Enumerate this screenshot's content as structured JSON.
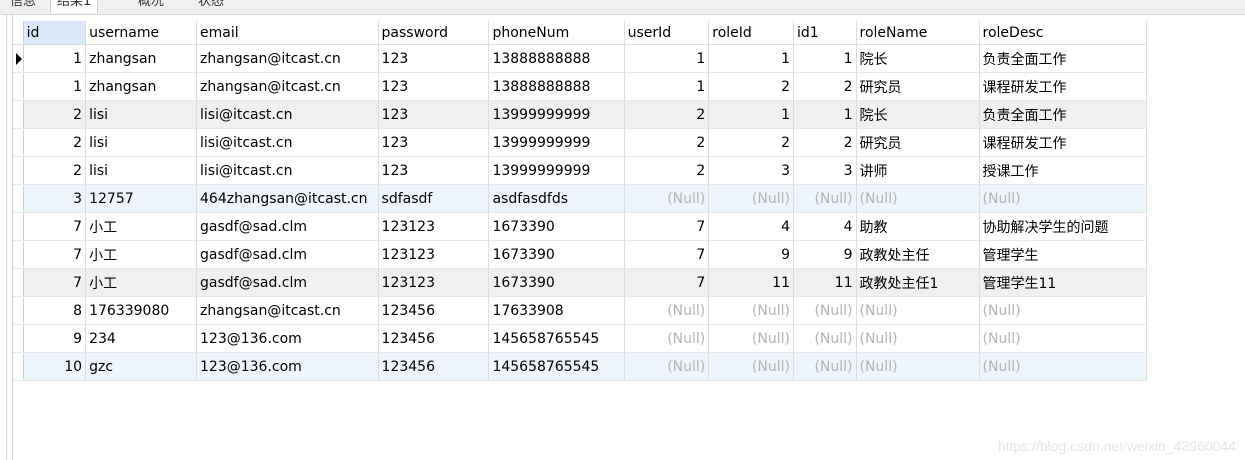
{
  "tabs": [
    {
      "label": "信息",
      "active": false
    },
    {
      "label": "结果1",
      "active": true
    },
    {
      "label": "概况",
      "active": false
    },
    {
      "label": "状态",
      "active": false
    }
  ],
  "null_text": "(Null)",
  "columns": [
    "id",
    "username",
    "email",
    "password",
    "phoneNum",
    "userId",
    "roleId",
    "id1",
    "roleName",
    "roleDesc"
  ],
  "rows": [
    [
      "1",
      "zhangsan",
      "zhangsan@itcast.cn",
      "123",
      "13888888888",
      "1",
      "1",
      "1",
      "院长",
      "负责全面工作"
    ],
    [
      "1",
      "zhangsan",
      "zhangsan@itcast.cn",
      "123",
      "13888888888",
      "1",
      "2",
      "2",
      "研究员",
      "课程研发工作"
    ],
    [
      "2",
      "lisi",
      "lisi@itcast.cn",
      "123",
      "13999999999",
      "2",
      "1",
      "1",
      "院长",
      "负责全面工作"
    ],
    [
      "2",
      "lisi",
      "lisi@itcast.cn",
      "123",
      "13999999999",
      "2",
      "2",
      "2",
      "研究员",
      "课程研发工作"
    ],
    [
      "2",
      "lisi",
      "lisi@itcast.cn",
      "123",
      "13999999999",
      "2",
      "3",
      "3",
      "讲师",
      "授课工作"
    ],
    [
      "3",
      "12757",
      "464zhangsan@itcast.cn",
      "sdfasdf",
      "asdfasdfds",
      null,
      null,
      null,
      null,
      null
    ],
    [
      "7",
      "小工",
      "gasdf@sad.clm",
      "123123",
      "1673390",
      "7",
      "4",
      "4",
      "助教",
      "协助解决学生的问题"
    ],
    [
      "7",
      "小工",
      "gasdf@sad.clm",
      "123123",
      "1673390",
      "7",
      "9",
      "9",
      "政教处主任",
      "管理学生"
    ],
    [
      "7",
      "小工",
      "gasdf@sad.clm",
      "123123",
      "1673390",
      "7",
      "11",
      "11",
      "政教处主任1",
      "管理学生11"
    ],
    [
      "8",
      "176339080",
      "zhangsan@itcast.cn",
      "123456",
      "17633908",
      null,
      null,
      null,
      null,
      null
    ],
    [
      "9",
      "234",
      "123@136.com",
      "123456",
      "145658765545",
      null,
      null,
      null,
      null,
      null
    ],
    [
      "10",
      "gzc",
      "123@136.com",
      "123456",
      "145658765545",
      null,
      null,
      null,
      null,
      null
    ]
  ],
  "watermark": "https://blog.csdn.net/weixin_43960044"
}
